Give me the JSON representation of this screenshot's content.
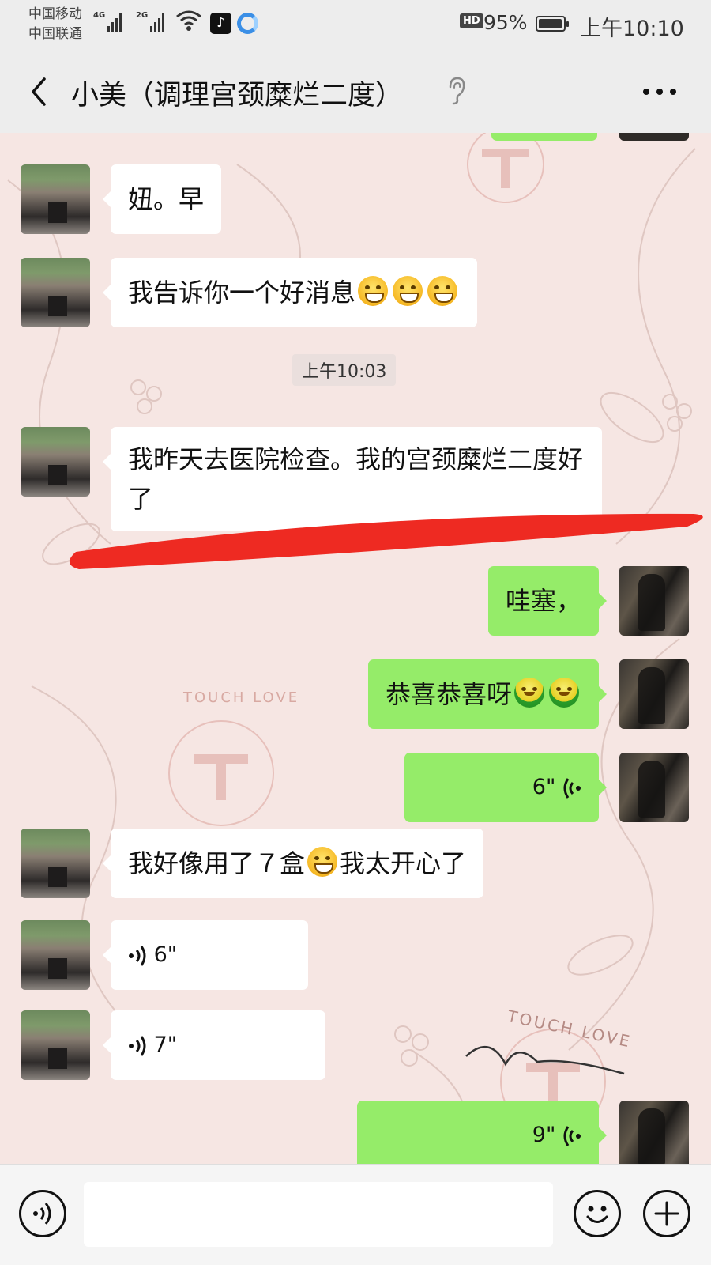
{
  "status_bar": {
    "carrier1": "中国移动",
    "carrier2": "中国联通",
    "net1": "4G",
    "net2": "2G",
    "hd": "HD",
    "battery_pct": "95%",
    "battery_level": 0.95,
    "time": "上午10:10"
  },
  "header": {
    "title": "小美（调理宫颈糜烂二度）",
    "icons": [
      "back-icon",
      "earpiece-icon",
      "more-icon"
    ]
  },
  "messages": [
    {
      "side": "in",
      "text": "妞。早"
    },
    {
      "side": "in",
      "text": "我告诉你一个好消息",
      "emoji_after": 3
    },
    {
      "timestamp": "上午10:03"
    },
    {
      "side": "in",
      "text": "我昨天去医院检查。我的宫颈糜烂二度好了"
    },
    {
      "side": "out",
      "text": "哇塞，"
    },
    {
      "side": "out",
      "text": "恭喜恭喜呀",
      "emoji_after": 2
    },
    {
      "side": "out",
      "voice": "6\""
    },
    {
      "side": "in",
      "text1": "我好像用了７盒",
      "text2": "我太开心了"
    },
    {
      "side": "in",
      "voice": "6\""
    },
    {
      "side": "in",
      "voice": "7\""
    },
    {
      "side": "out",
      "voice": "9\""
    }
  ],
  "watermark": "TOUCH LOVE",
  "colors": {
    "chat_bg": "#f6e6e3",
    "outgoing": "#95ec69",
    "incoming": "#ffffff",
    "annotation": "#ee2a22"
  },
  "input_bar": {
    "left_icon": "voice-icon",
    "right_icons": [
      "emoji-icon",
      "plus-icon"
    ]
  }
}
